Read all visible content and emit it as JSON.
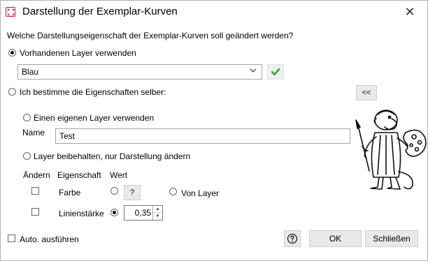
{
  "window": {
    "title": "Darstellung der Exemplar-Kurven",
    "close_label": "✕"
  },
  "question": "Welche Darstellungseigenschaft der Exemplar-Kurven soll geändert werden?",
  "option_existing_layer": {
    "label": "Vorhandenen Layer verwenden",
    "selected": true
  },
  "layer_select": {
    "value": "Blau",
    "confirm_icon": "checkmark-icon"
  },
  "option_custom": {
    "label": "Ich bestimme die Eigenschaften selber:",
    "selected": false,
    "collapse_button_label": "<<"
  },
  "option_own_layer": {
    "label": "Einen eigenen Layer verwenden",
    "selected": false
  },
  "name_field": {
    "label": "Name",
    "value": "Test"
  },
  "option_keep_layer": {
    "label": "Layer beibehalten, nur Darstellung ändern",
    "selected": false
  },
  "table": {
    "headers": [
      "Ändern",
      "Eigenschaft",
      "Wert"
    ],
    "rows": [
      {
        "property": "Farbe",
        "value_button": "?",
        "alt_label": "Von Layer"
      },
      {
        "property": "Linienstärke",
        "value": "0,35"
      }
    ]
  },
  "auto_execute": {
    "label": "Auto. ausführen",
    "checked": false
  },
  "buttons": {
    "help_icon": "help-icon",
    "ok": "OK",
    "close": "Schließen"
  },
  "colors": {
    "accent_red": "#c8102e",
    "check_green": "#2a9d2a"
  }
}
